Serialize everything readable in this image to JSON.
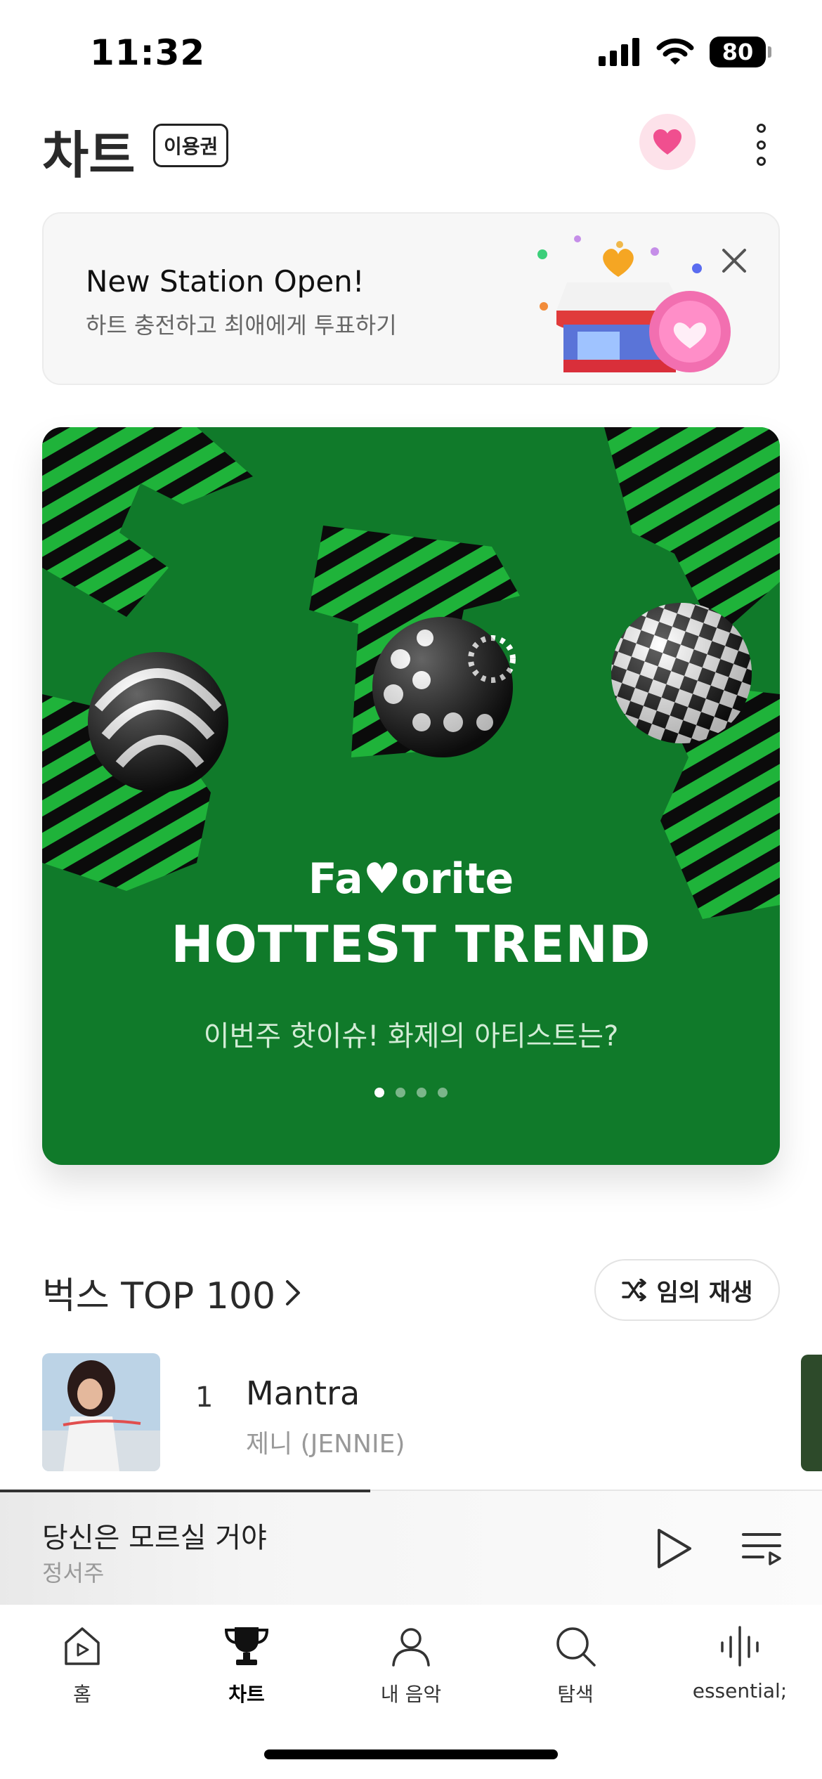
{
  "status_bar": {
    "time": "11:32",
    "battery": "80"
  },
  "header": {
    "title": "차트",
    "pass_badge": "이용권"
  },
  "promo": {
    "title": "New Station Open!",
    "subtitle": "하트 충전하고 최애에게 투표하기"
  },
  "banner": {
    "logo": "Fa♥orite",
    "title": "HOTTEST TREND",
    "subtitle": "이번주 핫이슈! 화제의 아티스트는?",
    "page_count": 4,
    "active_page": 1
  },
  "top100": {
    "title": "벅스 TOP 100",
    "shuffle_label": "임의 재생",
    "tracks": [
      {
        "rank": "1",
        "title": "Mantra",
        "artist": "제니 (JENNIE)"
      }
    ]
  },
  "mini_player": {
    "title": "당신은 모르실 거야",
    "artist": "정서주",
    "progress": 0.45
  },
  "tabs": [
    {
      "label": "홈",
      "icon": "home-icon",
      "active": false
    },
    {
      "label": "차트",
      "icon": "trophy-icon",
      "active": true
    },
    {
      "label": "내 음악",
      "icon": "person-icon",
      "active": false
    },
    {
      "label": "탐색",
      "icon": "search-icon",
      "active": false
    },
    {
      "label": "essential;",
      "icon": "waveform-icon",
      "active": false
    }
  ],
  "colors": {
    "banner_green": "#107a2a",
    "heart_pink": "#f04f8f"
  }
}
